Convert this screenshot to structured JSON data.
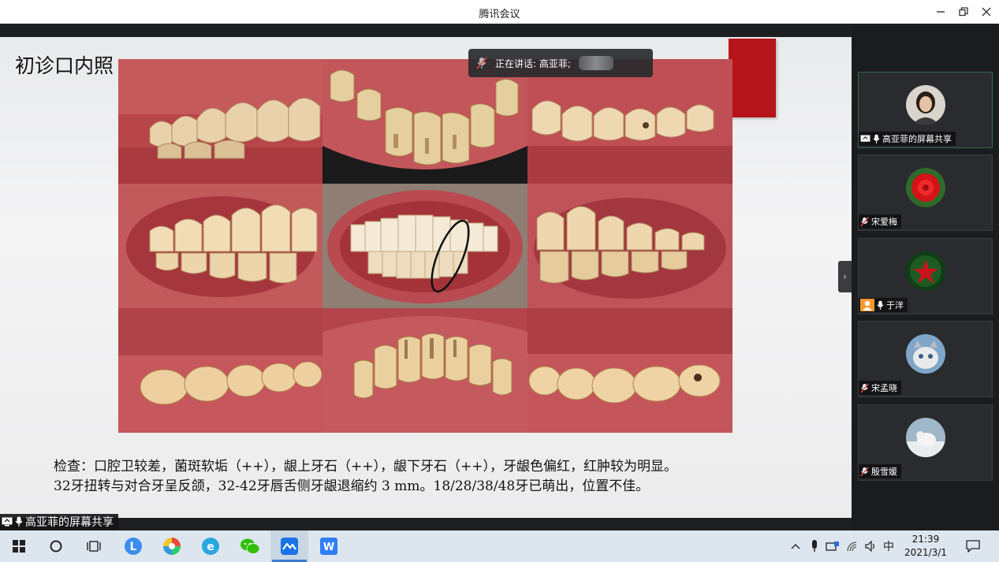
{
  "window": {
    "title": "腾讯会议"
  },
  "slide": {
    "title": "初诊口内照",
    "text_line1": "检查：口腔卫较差，菌斑软垢（++），龈上牙石（++），龈下牙石（++），牙龈色偏红，红肿较为明显。",
    "text_line2": "32牙扭转与对合牙呈反颌，32-42牙唇舌侧牙龈退缩约 3 mm。18/28/38/48牙已萌出，位置不佳。"
  },
  "speaking": {
    "label": "正在讲话: 高亚菲;"
  },
  "share_label": "高亚菲的屏幕共享",
  "participants": [
    {
      "name": "高亚菲的屏幕共享",
      "avatar": "woman-photo",
      "mic": "on",
      "sharing": true
    },
    {
      "name": "宋爱梅",
      "avatar": "red-flower",
      "mic": "muted"
    },
    {
      "name": "于洋",
      "avatar": "green-emblem",
      "mic": "on",
      "default_avatar_icon": true
    },
    {
      "name": "宋孟晓",
      "avatar": "kitten",
      "mic": "muted"
    },
    {
      "name": "殷雪媛",
      "avatar": "snowy-animal",
      "mic": "muted"
    }
  ],
  "taskbar": {
    "ime": "中",
    "time": "21:39",
    "date": "2021/3/1"
  },
  "colors": {
    "accent_red": "#b5141a",
    "active_tile_border": "#2c6b4e",
    "taskbar_bg": "#dde6ee"
  }
}
